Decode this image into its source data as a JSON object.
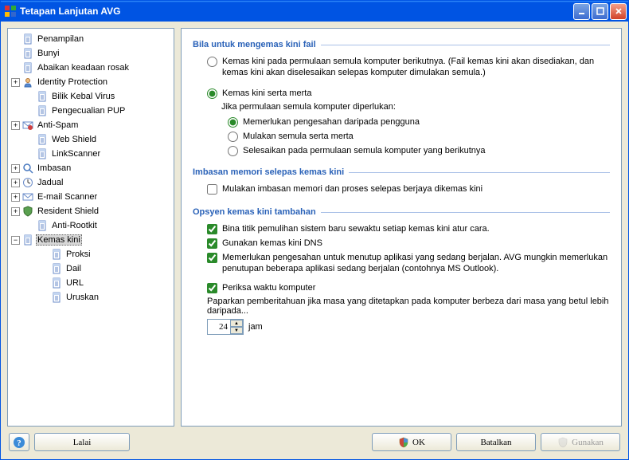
{
  "window": {
    "title": "Tetapan Lanjutan AVG"
  },
  "tree": {
    "items": [
      {
        "label": "Penampilan",
        "icon": "doc",
        "exp": "none"
      },
      {
        "label": "Bunyi",
        "icon": "doc",
        "exp": "none"
      },
      {
        "label": "Abaikan keadaan rosak",
        "icon": "doc",
        "exp": "none"
      },
      {
        "label": "Identity Protection",
        "icon": "identity",
        "exp": "plus"
      },
      {
        "label": "Bilik Kebal Virus",
        "icon": "doc",
        "exp": "none",
        "indent": 1
      },
      {
        "label": "Pengecualian PUP",
        "icon": "doc",
        "exp": "none",
        "indent": 1
      },
      {
        "label": "Anti-Spam",
        "icon": "antispam",
        "exp": "plus"
      },
      {
        "label": "Web Shield",
        "icon": "doc",
        "exp": "none",
        "indent": 1
      },
      {
        "label": "LinkScanner",
        "icon": "doc",
        "exp": "none",
        "indent": 1
      },
      {
        "label": "Imbasan",
        "icon": "search",
        "exp": "plus"
      },
      {
        "label": "Jadual",
        "icon": "clock",
        "exp": "plus"
      },
      {
        "label": "E-mail Scanner",
        "icon": "mail",
        "exp": "plus"
      },
      {
        "label": "Resident Shield",
        "icon": "shield",
        "exp": "plus"
      },
      {
        "label": "Anti-Rootkit",
        "icon": "doc",
        "exp": "none",
        "indent": 1
      },
      {
        "label": "Kemas kini",
        "icon": "doc",
        "exp": "minus",
        "selected": true
      },
      {
        "label": "Proksi",
        "icon": "doc",
        "exp": "none",
        "indent": 2
      },
      {
        "label": "Dail",
        "icon": "doc",
        "exp": "none",
        "indent": 2
      },
      {
        "label": "URL",
        "icon": "doc",
        "exp": "none",
        "indent": 2
      },
      {
        "label": "Uruskan",
        "icon": "doc",
        "exp": "none",
        "indent": 2
      }
    ]
  },
  "sections": {
    "s1": {
      "title": "Bila untuk mengemas kini fail",
      "opt1": "Kemas kini pada permulaan semula komputer berikutnya. (Fail kemas kini akan disediakan, dan kemas kini akan diselesaikan selepas komputer dimulakan semula.)",
      "opt2": "Kemas kini serta merta",
      "desc": "Jika permulaan semula komputer diperlukan:",
      "sub1": "Memerlukan pengesahan daripada pengguna",
      "sub2": "Mulakan semula serta merta",
      "sub3": "Selesaikan pada permulaan semula komputer yang berikutnya"
    },
    "s2": {
      "title": "Imbasan memori selepas kemas kini",
      "chk1": "Mulakan imbasan memori dan proses selepas berjaya dikemas kini"
    },
    "s3": {
      "title": "Opsyen kemas kini tambahan",
      "chk1": "Bina titik pemulihan sistem baru sewaktu setiap kemas kini atur cara.",
      "chk2": "Gunakan kemas kini DNS",
      "chk3": "Memerlukan pengesahan untuk menutup aplikasi yang sedang berjalan. AVG mungkin memerlukan penutupan beberapa aplikasi sedang berjalan (contohnya MS Outlook).",
      "chk4": "Periksa waktu komputer",
      "note": "Paparkan pemberitahuan jika masa yang ditetapkan pada komputer berbeza dari masa yang betul lebih daripada...",
      "hours_value": "24",
      "hours_unit": "jam"
    }
  },
  "buttons": {
    "default": "Lalai",
    "ok": "OK",
    "cancel": "Batalkan",
    "apply": "Gunakan"
  }
}
